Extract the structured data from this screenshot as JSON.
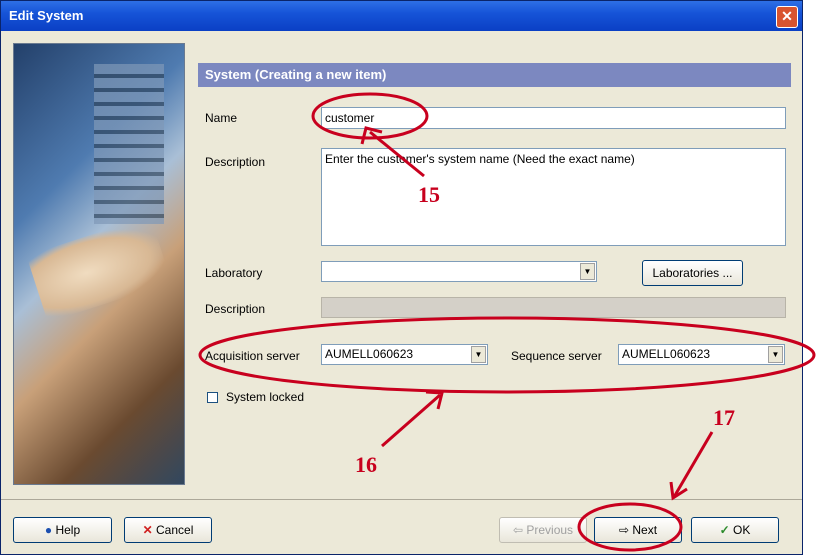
{
  "window": {
    "title": "Edit System",
    "close_glyph": "✕"
  },
  "section": {
    "header": "System (Creating a new item)"
  },
  "form": {
    "name_label": "Name",
    "name_value": "customer",
    "description_label": "Description",
    "description_value": "Enter the customer's system name (Need the exact name)",
    "laboratory_label": "Laboratory",
    "laboratory_value": "",
    "laboratories_button": "Laboratories ...",
    "lab_description_label": "Description",
    "lab_description_value": "",
    "acquisition_label": "Acquisition server",
    "acquisition_value": "AUMELL060623",
    "sequence_label": "Sequence server",
    "sequence_value": "AUMELL060623",
    "system_locked_label": "System locked"
  },
  "buttons": {
    "help": "Help",
    "cancel": "Cancel",
    "previous": "Previous",
    "next": "Next",
    "ok": "OK"
  },
  "annotations": {
    "a15": "15",
    "a16": "16",
    "a17": "17"
  },
  "colors": {
    "annotation": "#c8001e",
    "header": "#7c88c0",
    "title_bar": "#1654d8"
  }
}
